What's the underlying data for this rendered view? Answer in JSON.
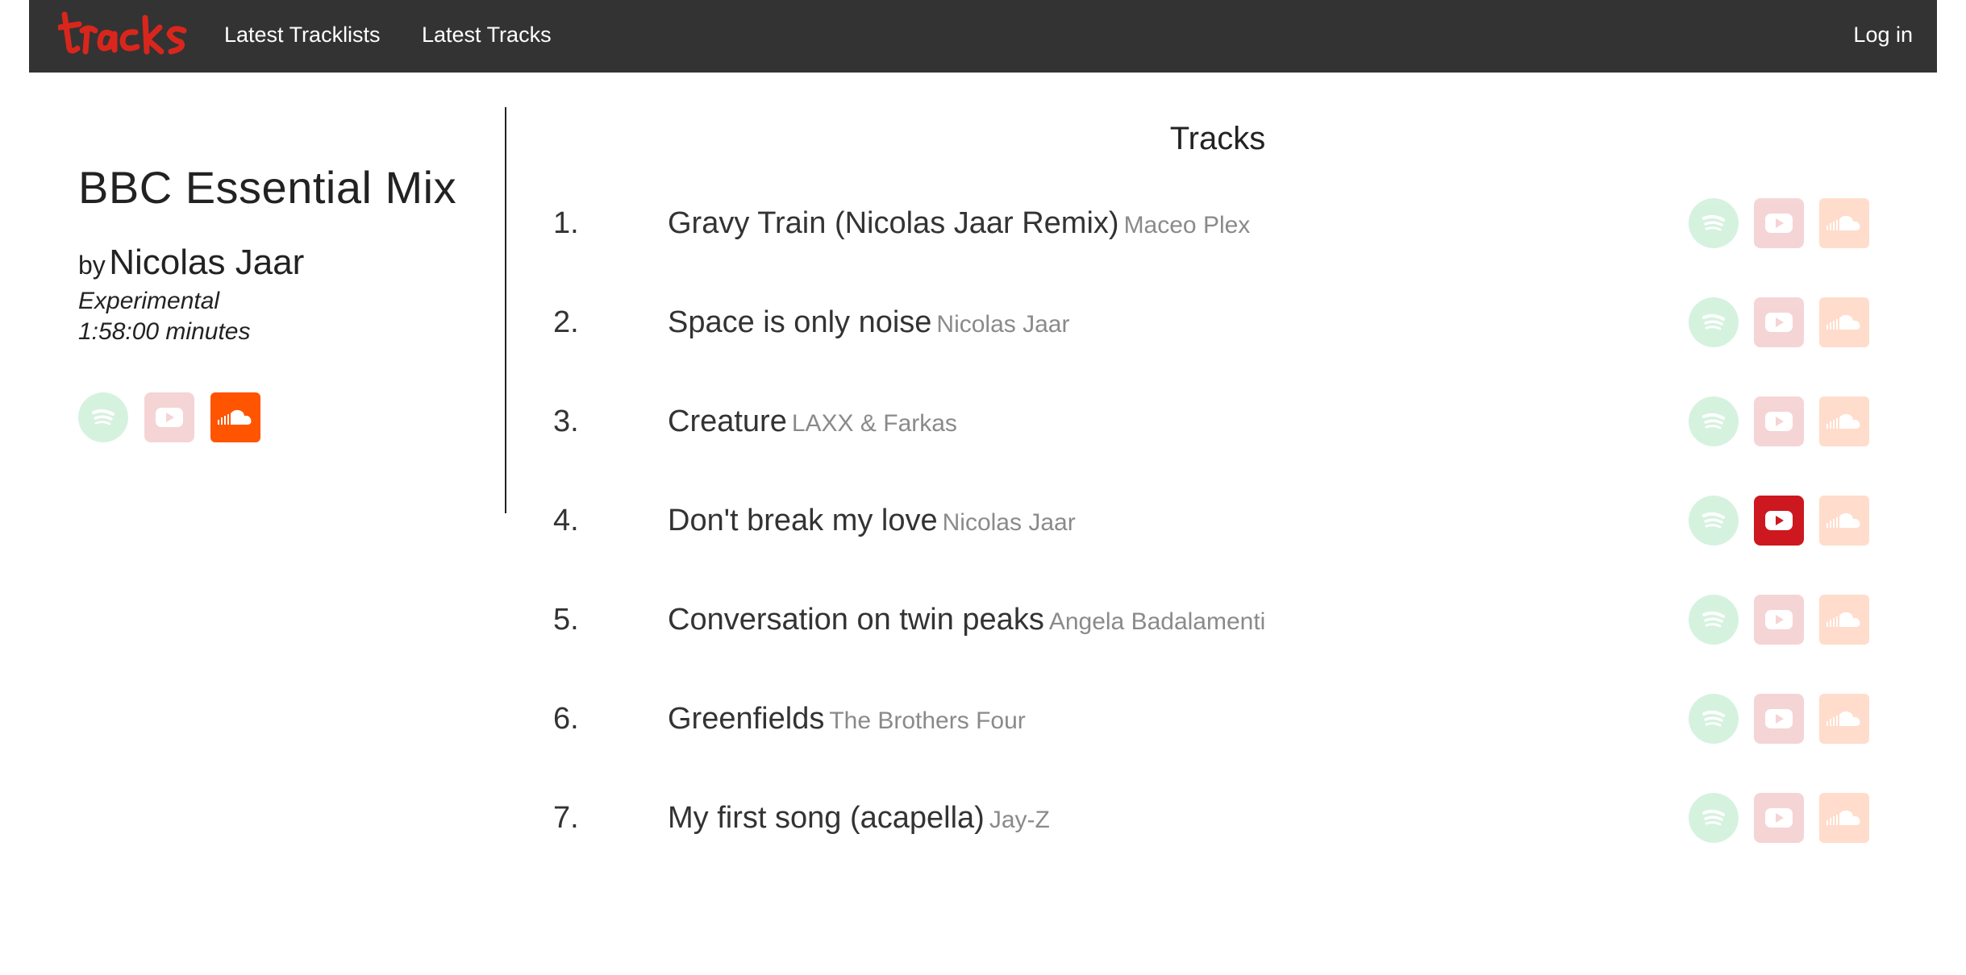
{
  "nav": {
    "logo_text": "tracks",
    "links": [
      "Latest Tracklists",
      "Latest Tracks"
    ],
    "login": "Log in"
  },
  "mix": {
    "title": "BBC Essential Mix",
    "by": "by",
    "artist": "Nicolas Jaar",
    "genre": "Experimental",
    "duration": "1:58:00 minutes",
    "services": [
      {
        "icon": "spotify-icon",
        "active": false
      },
      {
        "icon": "youtube-icon",
        "active": false
      },
      {
        "icon": "soundcloud-icon",
        "active": true
      }
    ]
  },
  "tracks_heading": "Tracks",
  "tracks": [
    {
      "num": "1.",
      "title": "Gravy Train (Nicolas Jaar Remix)",
      "artist": "Maceo Plex",
      "spotify": false,
      "youtube": false,
      "soundcloud": false
    },
    {
      "num": "2.",
      "title": "Space is only noise",
      "artist": "Nicolas Jaar",
      "spotify": false,
      "youtube": false,
      "soundcloud": false
    },
    {
      "num": "3.",
      "title": "Creature",
      "artist": "LAXX & Farkas",
      "spotify": false,
      "youtube": false,
      "soundcloud": false
    },
    {
      "num": "4.",
      "title": "Don't break my love",
      "artist": "Nicolas Jaar",
      "spotify": false,
      "youtube": true,
      "soundcloud": false
    },
    {
      "num": "5.",
      "title": "Conversation on twin peaks",
      "artist": "Angela Badalamenti",
      "spotify": false,
      "youtube": false,
      "soundcloud": false
    },
    {
      "num": "6.",
      "title": "Greenfields",
      "artist": "The Brothers Four",
      "spotify": false,
      "youtube": false,
      "soundcloud": false
    },
    {
      "num": "7.",
      "title": "My first song (acapella)",
      "artist": "Jay-Z",
      "spotify": false,
      "youtube": false,
      "soundcloud": false
    }
  ],
  "colors": {
    "navbar": "#333333",
    "logo": "#d9261c",
    "spotify": "#1db954",
    "youtube": "#cc181e",
    "soundcloud": "#ff5500",
    "artist_text": "#8a8a8a"
  }
}
